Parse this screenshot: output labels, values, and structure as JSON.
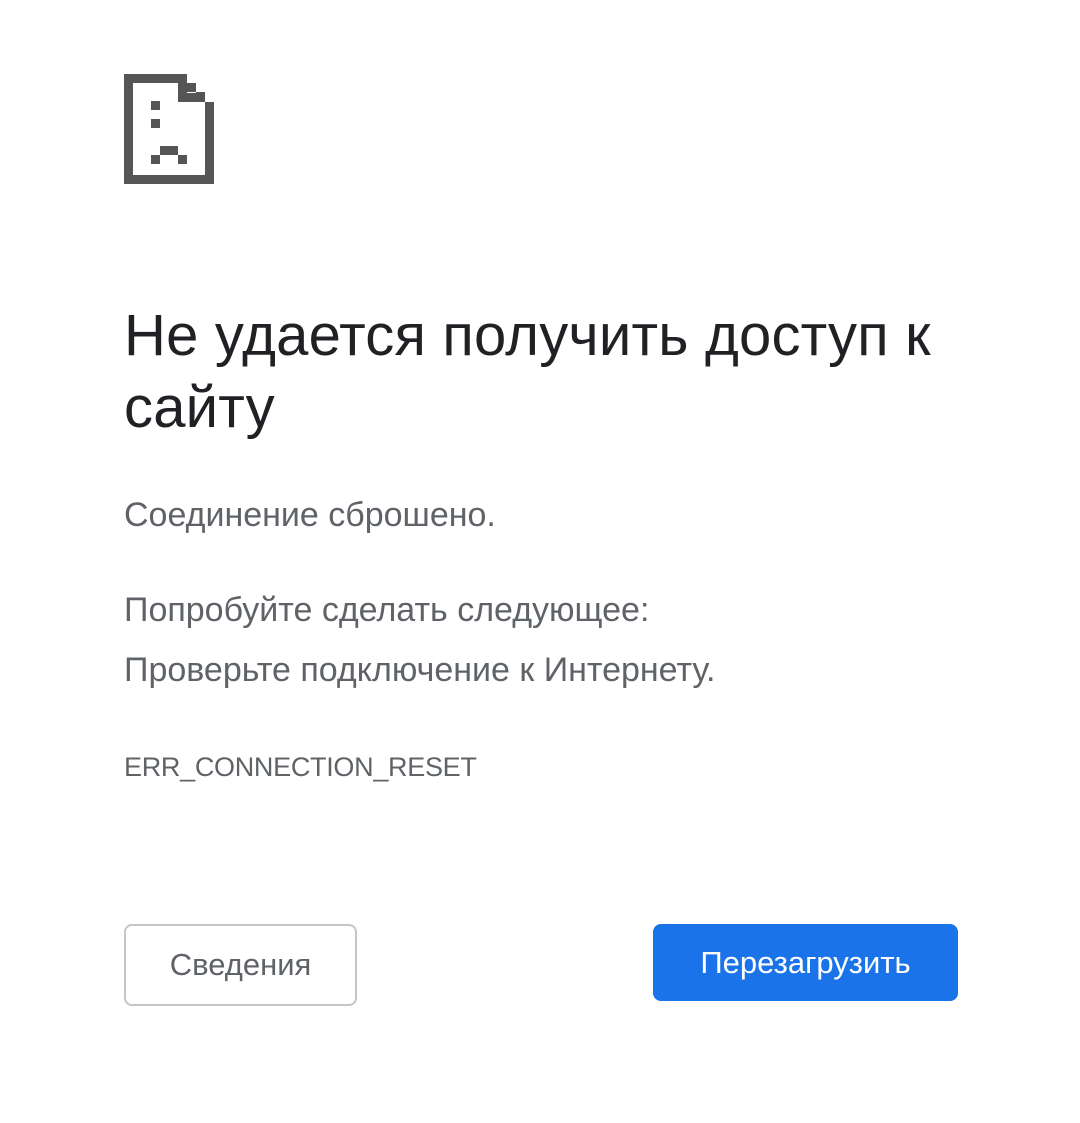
{
  "icon": {
    "name": "sad-page-icon",
    "color": "#555555"
  },
  "main": {
    "headline": "Не удается получить доступ к сайту",
    "summary": "Соединение сброшено.",
    "suggestions_heading": "Попробуйте сделать следующее:",
    "suggestions": [
      "Проверьте подключение к Интернету."
    ],
    "error_code": "ERR_CONNECTION_RESET"
  },
  "buttons": {
    "details_label": "Сведения",
    "reload_label": "Перезагрузить"
  },
  "colors": {
    "primary_button": "#1a73e8",
    "headline_text": "#202124",
    "body_text": "#5f6368"
  }
}
